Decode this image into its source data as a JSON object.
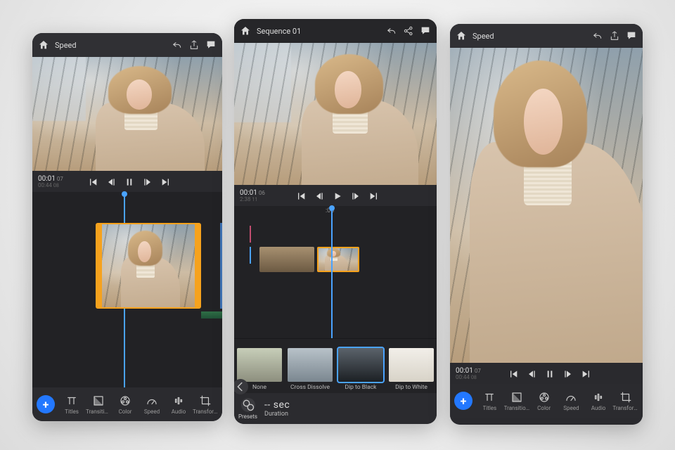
{
  "topbar": {
    "speed_label": "Speed",
    "sequence_label": "Sequence 01"
  },
  "time_p1": {
    "main": "00:01",
    "main_frames": "07",
    "sub": "00:44",
    "sub_frames": "08"
  },
  "time_p2": {
    "main": "00:01",
    "main_frames": "06",
    "sub": "2:38",
    "sub_frames": "11",
    "ruler": ":00"
  },
  "time_p3": {
    "main": "00:01",
    "main_frames": "07",
    "sub": "00:44",
    "sub_frames": "08"
  },
  "toolbar": {
    "items": [
      {
        "label": "Titles"
      },
      {
        "label": "Transitions"
      },
      {
        "label": "Color"
      },
      {
        "label": "Speed"
      },
      {
        "label": "Audio"
      },
      {
        "label": "Transform"
      }
    ]
  },
  "transitions": {
    "items": [
      {
        "label": "None"
      },
      {
        "label": "Cross Dissolve"
      },
      {
        "label": "Dip to Black",
        "selected": true
      },
      {
        "label": "Dip to White"
      }
    ]
  },
  "presets": {
    "button_label": "Presets",
    "duration_label": "Duration",
    "duration_value": "-- sec"
  }
}
